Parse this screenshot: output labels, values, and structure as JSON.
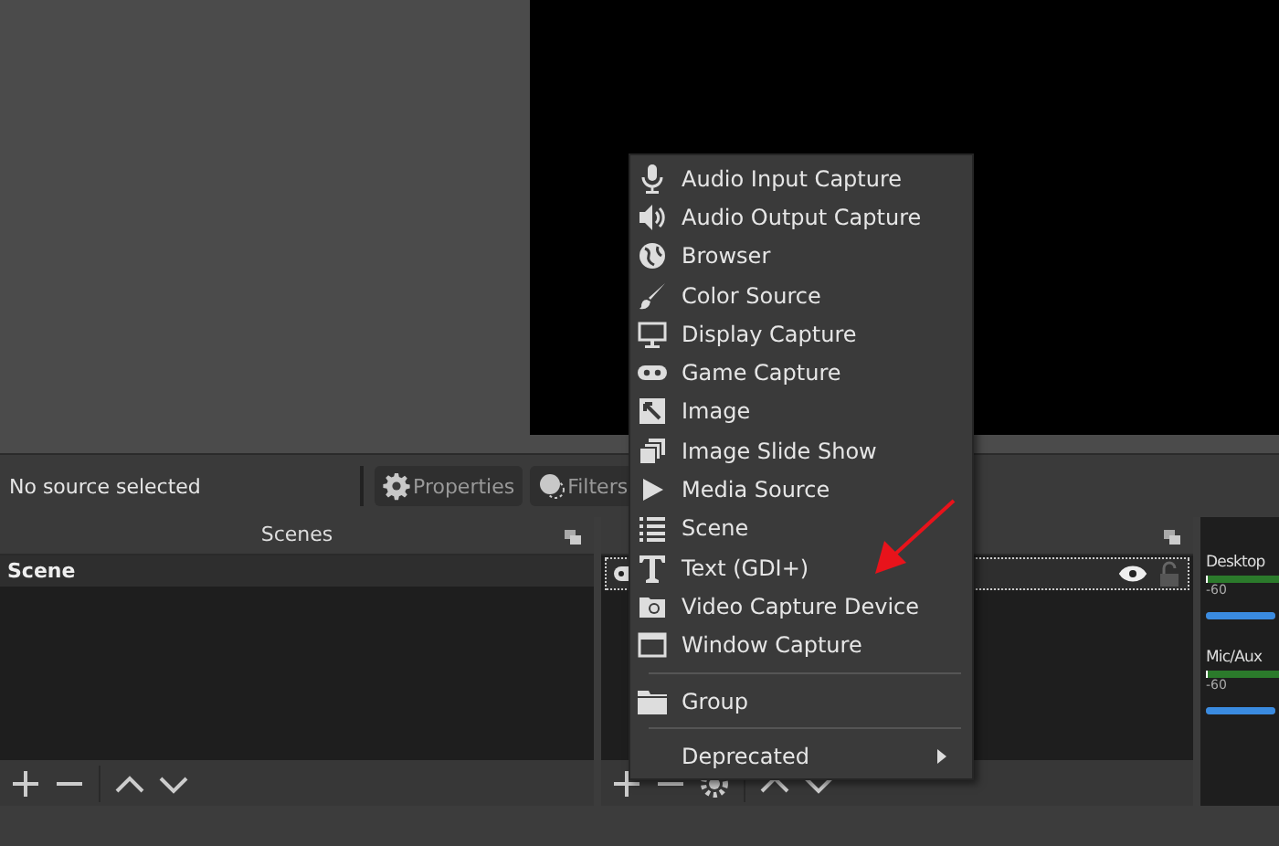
{
  "source_bar": {
    "status": "No source selected",
    "buttons": [
      {
        "label": "Properties",
        "kind": "gear"
      },
      {
        "label": "Filters",
        "kind": "filter"
      }
    ]
  },
  "scenes_dock": {
    "title": "Scenes",
    "items": [
      {
        "label": "Scene",
        "selected": true
      }
    ]
  },
  "sources_dock": {
    "items": [
      {
        "visible": true,
        "locked": false,
        "selected": true
      }
    ]
  },
  "mixer": {
    "channels": [
      {
        "name": "Desktop",
        "scale": "-60",
        "level": 1
      },
      {
        "name": "Mic/Aux",
        "scale": "-60",
        "level": 1
      }
    ]
  },
  "menu": {
    "items": [
      {
        "kind": "mic",
        "label": "Audio Input Capture"
      },
      {
        "kind": "speaker",
        "label": "Audio Output Capture"
      },
      {
        "kind": "globe",
        "label": "Browser"
      },
      {
        "kind": "brush",
        "label": "Color Source"
      },
      {
        "kind": "monitor",
        "label": "Display Capture"
      },
      {
        "kind": "gamepad",
        "label": "Game Capture"
      },
      {
        "kind": "image",
        "label": "Image"
      },
      {
        "kind": "slides",
        "label": "Image Slide Show"
      },
      {
        "kind": "play",
        "label": "Media Source"
      },
      {
        "kind": "list",
        "label": "Scene"
      },
      {
        "kind": "text",
        "label": "Text (GDI+)"
      },
      {
        "kind": "camera",
        "label": "Video Capture Device"
      },
      {
        "kind": "window",
        "label": "Window Capture"
      },
      {
        "kind": "separator"
      },
      {
        "kind": "folder",
        "label": "Group"
      },
      {
        "kind": "separator"
      },
      {
        "kind": "submenu",
        "label": "Deprecated"
      }
    ]
  }
}
